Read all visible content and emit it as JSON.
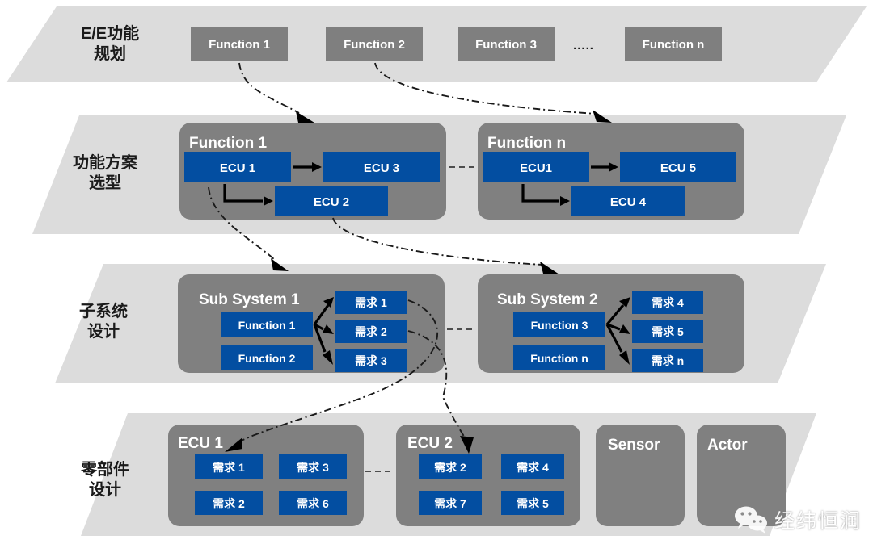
{
  "diagram": {
    "title": "E/E Development V-Model Layers",
    "colors": {
      "band": "#dcdcdc",
      "group": "#808080",
      "gray_box": "#7f7f7f",
      "blue_box": "#034ea1",
      "arrow": "#000000",
      "label_text": "#1a1a1a",
      "box_text": "#ffffff"
    },
    "bands": [
      {
        "label_line1": "E/E功能",
        "label_line2": "规划",
        "name": "ee-function-planning"
      },
      {
        "label_line1": "功能方案",
        "label_line2": "选型",
        "name": "function-solution-selection"
      },
      {
        "label_line1": "子系统",
        "label_line2": "设计",
        "name": "subsystem-design"
      },
      {
        "label_line1": "零部件",
        "label_line2": "设计",
        "name": "component-design"
      }
    ],
    "row1": {
      "boxes": [
        "Function 1",
        "Function 2",
        "Function 3",
        "Function n"
      ],
      "ellipsis": "....."
    },
    "row2": {
      "groups": [
        {
          "title": "Function 1",
          "boxes": [
            "ECU 1",
            "ECU 3",
            "ECU 2"
          ]
        },
        {
          "title": "Function n",
          "boxes": [
            "ECU1",
            "ECU 5",
            "ECU 4"
          ]
        }
      ]
    },
    "row3": {
      "groups": [
        {
          "title": "Sub System 1",
          "functions": [
            "Function 1",
            "Function 2"
          ],
          "requirements": [
            "需求 1",
            "需求 2",
            "需求 3"
          ]
        },
        {
          "title": "Sub System 2",
          "functions": [
            "Function 3",
            "Function n"
          ],
          "requirements": [
            "需求 4",
            "需求 5",
            "需求 n"
          ]
        }
      ]
    },
    "row4": {
      "groups": [
        {
          "title": "ECU 1",
          "boxes": [
            "需求 1",
            "需求 3",
            "需求 2",
            "需求 6"
          ]
        },
        {
          "title": "ECU 2",
          "boxes": [
            "需求 2",
            "需求 4",
            "需求 7",
            "需求 5"
          ]
        }
      ],
      "plain": [
        "Sensor",
        "Actor"
      ]
    },
    "watermark": {
      "text": "经纬恒润",
      "icon": "wechat-icon"
    }
  }
}
